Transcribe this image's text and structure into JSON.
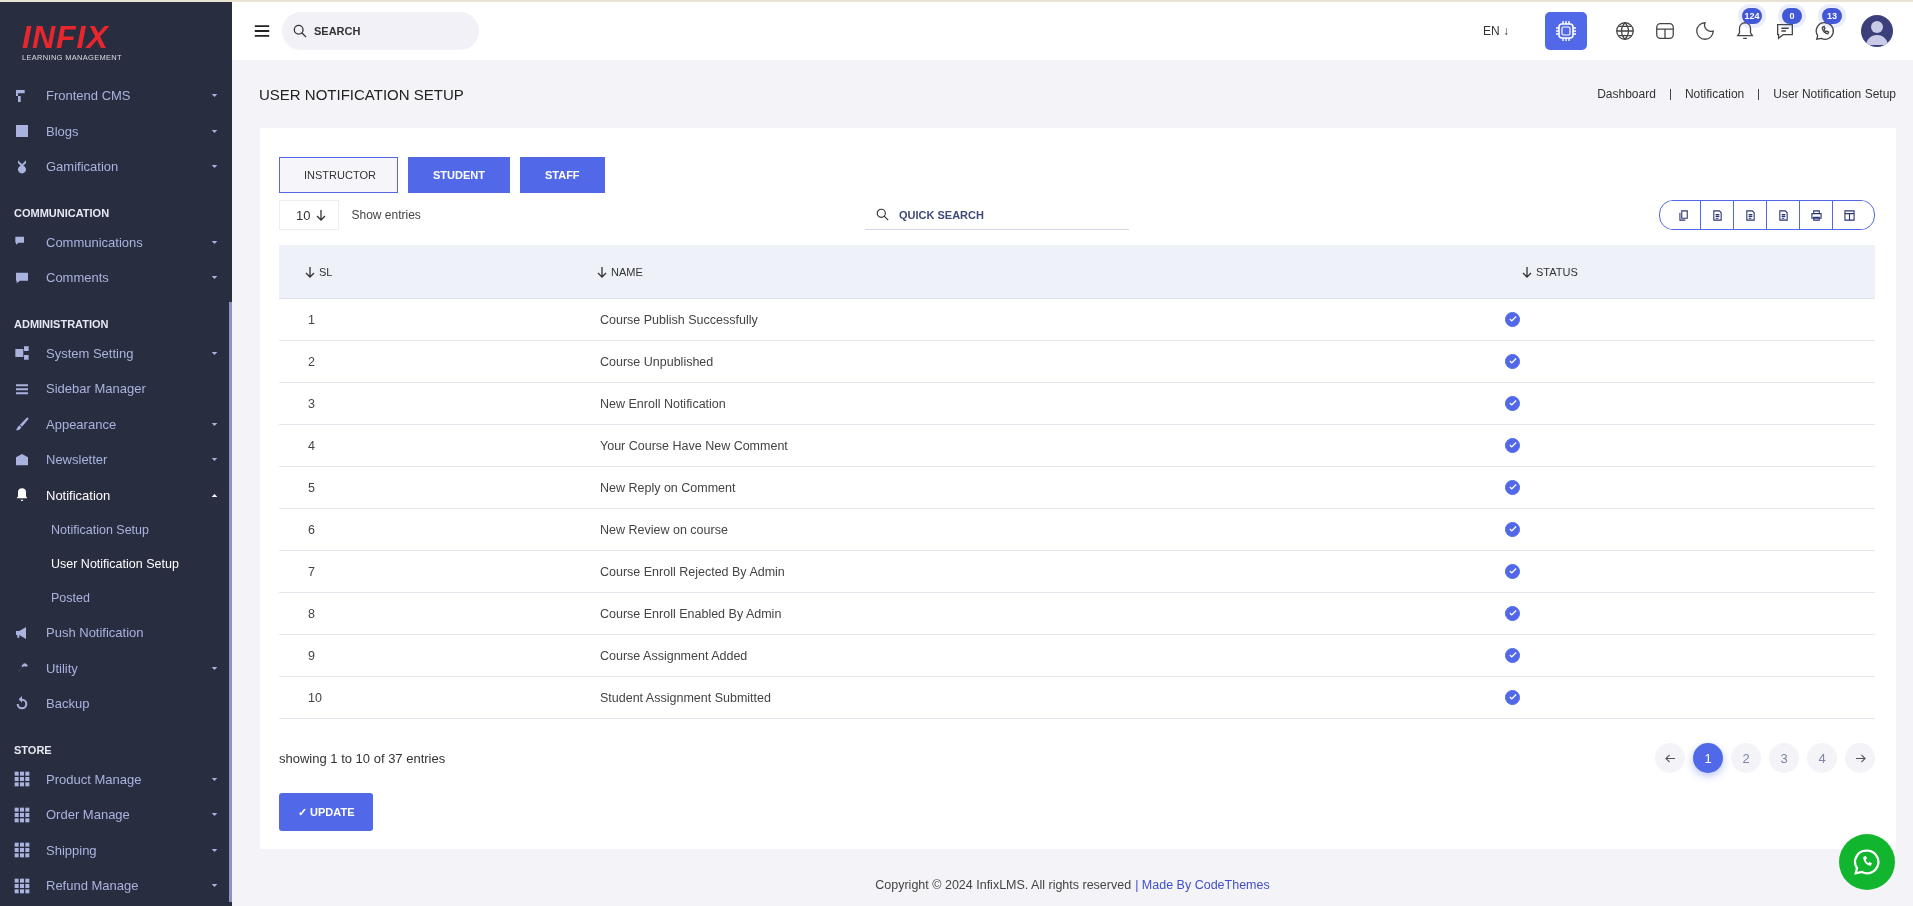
{
  "logo": {
    "title": "INFIX",
    "subtitle": "LEARNING MANAGEMENT"
  },
  "sidebar": {
    "items": [
      {
        "kind": "item",
        "label": "Frontend CMS",
        "expanded": false
      },
      {
        "kind": "item",
        "label": "Blogs",
        "expanded": false
      },
      {
        "kind": "item",
        "label": "Gamification",
        "expanded": false
      },
      {
        "kind": "section",
        "label": "COMMUNICATION"
      },
      {
        "kind": "item",
        "label": "Communications",
        "expanded": false
      },
      {
        "kind": "item",
        "label": "Comments",
        "expanded": false
      },
      {
        "kind": "section",
        "label": "ADMINISTRATION"
      },
      {
        "kind": "item",
        "label": "System Setting",
        "expanded": false
      },
      {
        "kind": "item",
        "label": "Sidebar Manager"
      },
      {
        "kind": "item",
        "label": "Appearance",
        "expanded": false
      },
      {
        "kind": "item",
        "label": "Newsletter",
        "expanded": false
      },
      {
        "kind": "item",
        "label": "Notification",
        "expanded": true,
        "children": [
          {
            "label": "Notification Setup",
            "selected": false
          },
          {
            "label": "User Notification Setup",
            "selected": true
          },
          {
            "label": "Posted",
            "selected": false
          }
        ]
      },
      {
        "kind": "item",
        "label": "Push Notification"
      },
      {
        "kind": "item",
        "label": "Utility",
        "expanded": false
      },
      {
        "kind": "item",
        "label": "Backup"
      },
      {
        "kind": "section",
        "label": "STORE"
      },
      {
        "kind": "item",
        "label": "Product Manage",
        "expanded": false
      },
      {
        "kind": "item",
        "label": "Order Manage",
        "expanded": false
      },
      {
        "kind": "item",
        "label": "Shipping",
        "expanded": false
      },
      {
        "kind": "item",
        "label": "Refund Manage",
        "expanded": false
      }
    ]
  },
  "header": {
    "search": {
      "placeholder": "SEARCH"
    },
    "language": "EN ↓",
    "badges": [
      {
        "count": "124"
      },
      {
        "count": "0"
      },
      {
        "count": "13"
      }
    ]
  },
  "page": {
    "title": "USER NOTIFICATION SETUP",
    "breadcrumb": [
      "Dashboard",
      "Notification",
      "User Notification Setup"
    ]
  },
  "tabs": [
    {
      "label": "INSTRUCTOR",
      "selected": true
    },
    {
      "label": "STUDENT",
      "selected": false
    },
    {
      "label": "STAFF",
      "selected": false
    }
  ],
  "table": {
    "length": "10",
    "show_entries": "Show entries",
    "search": {
      "placeholder": "QUICK SEARCH"
    },
    "columns": [
      "SL",
      "NAME",
      "STATUS"
    ],
    "rows": [
      {
        "sl": "1",
        "name": "Course Publish Successfully",
        "checked": true
      },
      {
        "sl": "2",
        "name": "Course Unpublished",
        "checked": true
      },
      {
        "sl": "3",
        "name": "New Enroll Notification",
        "checked": true
      },
      {
        "sl": "4",
        "name": "Your Course Have New Comment",
        "checked": true
      },
      {
        "sl": "5",
        "name": "New Reply on Comment",
        "checked": true
      },
      {
        "sl": "6",
        "name": "New Review on course",
        "checked": true
      },
      {
        "sl": "7",
        "name": "Course Enroll Rejected By Admin",
        "checked": true
      },
      {
        "sl": "8",
        "name": "Course Enroll Enabled By Admin",
        "checked": true
      },
      {
        "sl": "9",
        "name": "Course Assignment Added",
        "checked": true
      },
      {
        "sl": "10",
        "name": "Student Assignment Submitted",
        "checked": true
      }
    ],
    "info": "showing 1 to 10 of 37 entries",
    "pages": [
      {
        "label": "1",
        "selected": true
      },
      {
        "label": "2",
        "selected": false
      },
      {
        "label": "3",
        "selected": false
      },
      {
        "label": "4",
        "selected": false
      }
    ]
  },
  "update_button": "✓ UPDATE",
  "footer": {
    "text": "Copyright © 2024 InfixLMS. All rights reserved",
    "link": "| Made By CodeThemes"
  }
}
